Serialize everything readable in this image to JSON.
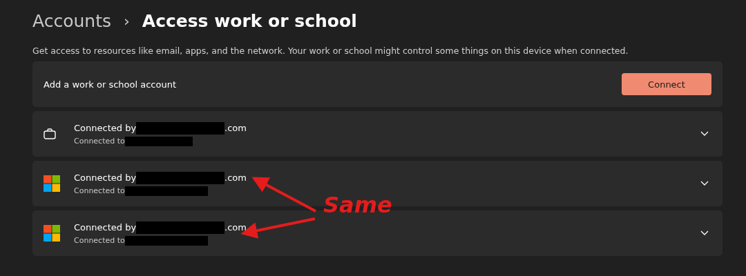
{
  "breadcrumb": {
    "parent": "Accounts",
    "separator": "›",
    "current": "Access work or school"
  },
  "description": "Get access to resources like email, apps, and the network. Your work or school might control some things on this device when connected.",
  "add_account": {
    "label": "Add a work or school account",
    "button": "Connect"
  },
  "accounts": [
    {
      "kind": "briefcase",
      "title": "Connected by",
      "suffix": ".com",
      "subtitle": "Connected to",
      "expanded": false
    },
    {
      "kind": "microsoft",
      "title": "Connected by",
      "suffix": ".com",
      "subtitle": "Connected to",
      "expanded": false
    },
    {
      "kind": "microsoft",
      "title": "Connected by",
      "suffix": ".com",
      "subtitle": "Connected to",
      "expanded": false
    }
  ],
  "annotation": {
    "text": "Same"
  }
}
